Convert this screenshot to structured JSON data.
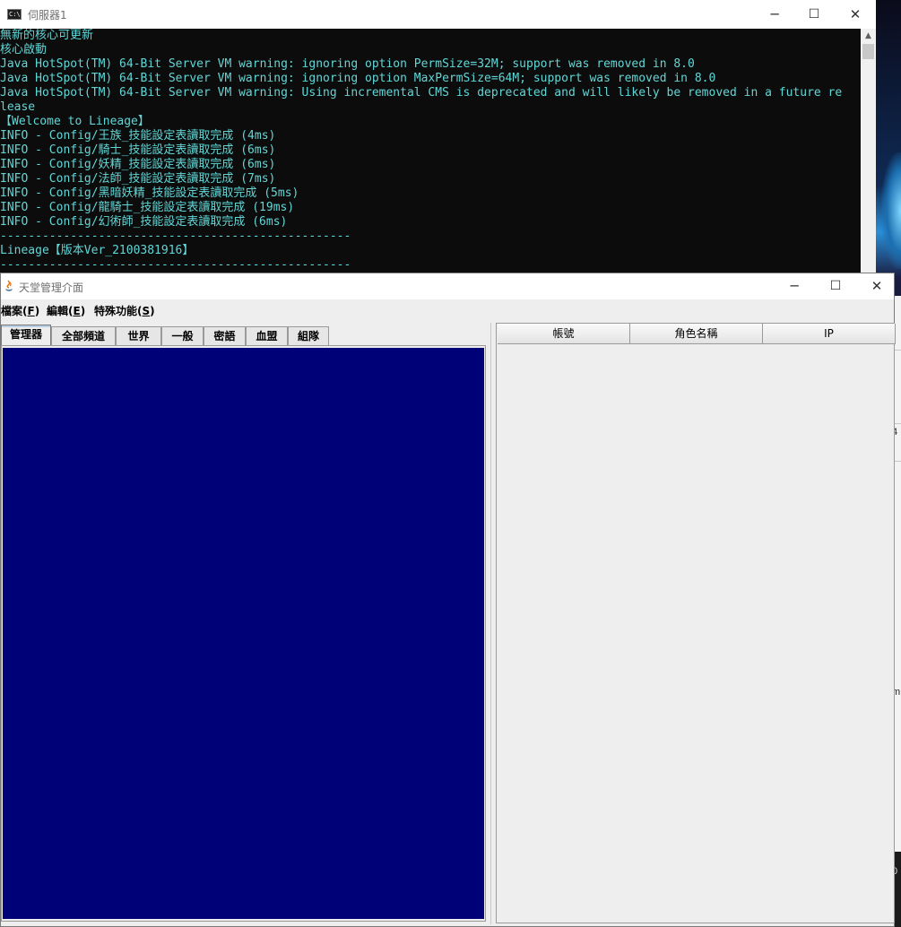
{
  "console": {
    "title": "伺服器1",
    "icon": "cmd-icon",
    "icon_text": "C:\\",
    "lines": [
      {
        "text": "無新的核心可更新",
        "color": "cyan"
      },
      {
        "text": "核心啟動",
        "color": "cyan"
      },
      {
        "text": "Java HotSpot(TM) 64-Bit Server VM warning: ignoring option PermSize=32M; support was removed in 8.0",
        "color": "cyan"
      },
      {
        "text": "Java HotSpot(TM) 64-Bit Server VM warning: ignoring option MaxPermSize=64M; support was removed in 8.0",
        "color": "cyan"
      },
      {
        "text": "Java HotSpot(TM) 64-Bit Server VM warning: Using incremental CMS is deprecated and will likely be removed in a future re",
        "color": "cyan"
      },
      {
        "text": "lease",
        "color": "cyan"
      },
      {
        "text": "【Welcome to Lineage】",
        "color": "cyan"
      },
      {
        "text": "INFO - Config/王族_技能設定表讀取完成 (4ms)",
        "color": "cyan"
      },
      {
        "text": "INFO - Config/騎士_技能設定表讀取完成 (6ms)",
        "color": "cyan"
      },
      {
        "text": "INFO - Config/妖精_技能設定表讀取完成 (6ms)",
        "color": "cyan"
      },
      {
        "text": "INFO - Config/法師_技能設定表讀取完成 (7ms)",
        "color": "cyan"
      },
      {
        "text": "INFO - Config/黑暗妖精_技能設定表讀取完成 (5ms)",
        "color": "cyan"
      },
      {
        "text": "INFO - Config/龍騎士_技能設定表讀取完成 (19ms)",
        "color": "cyan"
      },
      {
        "text": "INFO - Config/幻術師_技能設定表讀取完成 (6ms)",
        "color": "cyan"
      },
      {
        "text": "--------------------------------------------------",
        "color": "cyan"
      },
      {
        "text": "Lineage【版本Ver_2100381916】",
        "color": "cyan"
      },
      {
        "text": "--------------------------------------------------",
        "color": "cyan"
      }
    ]
  },
  "java_window": {
    "title": "天堂管理介面",
    "icon": "java-icon",
    "menu": [
      {
        "label": "檔案",
        "mnemonic": "F"
      },
      {
        "label": "編輯",
        "mnemonic": "E"
      },
      {
        "label": "特殊功能",
        "mnemonic": "S"
      }
    ],
    "tabs": [
      "管理器",
      "全部頻道",
      "世界",
      "一般",
      "密語",
      "血盟",
      "組隊"
    ],
    "active_tab": 0,
    "table_headers": [
      "帳號",
      "角色名稱",
      "IP"
    ],
    "colors": {
      "console_bg": "#0c0c0c",
      "console_text": "#61d6d6",
      "tab_panel_bg": "#000077"
    }
  },
  "window_controls": {
    "minimize": "─",
    "maximize": "☐",
    "close": "✕"
  },
  "background_fragments": [
    "4",
    "j",
    "m",
    "0"
  ]
}
